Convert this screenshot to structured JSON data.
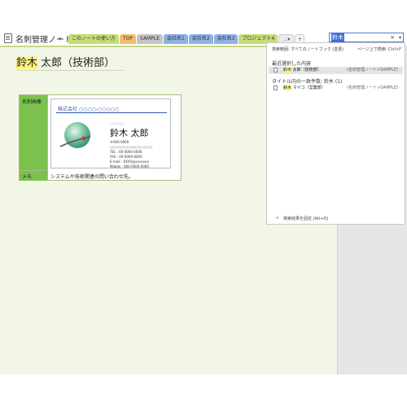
{
  "notebook": {
    "title": "名刺管理ノート",
    "caret": "▾"
  },
  "section_tabs": [
    {
      "label": "このノートの使い方",
      "color": "#c5dd77"
    },
    {
      "label": "TOP",
      "color": "#f4bd6b"
    },
    {
      "label": "SAMPLE",
      "color": "#c5c5c5"
    },
    {
      "label": "会社名1",
      "color": "#8fb1e6"
    },
    {
      "label": "会社名2",
      "color": "#8fb1e6"
    },
    {
      "label": "会社名3",
      "color": "#8fb1e6"
    },
    {
      "label": "プロジェクト4",
      "color": "#c5dd77"
    }
  ],
  "tab_more": "…▾",
  "tab_add": "+",
  "search": {
    "query": "鈴木",
    "close": "×",
    "dropdown": "▾"
  },
  "page": {
    "title_highlight": "鈴木",
    "title_rest": " 太郎（技術部）"
  },
  "table": {
    "label_card_image": "名刺画像",
    "label_memo": "メモ",
    "memo_text": "システムや技術関連の問い合わせ先。"
  },
  "card": {
    "company": "株式会社 ○○○○-○○○○○",
    "small": "○○○○○",
    "name": "鈴木 太郎",
    "postal": "〒000-0000",
    "address": "○○○○○○○○○○○○○○○",
    "tel": "TEL : 00-0000-0000",
    "fax": "FAX : 00-0000-0000",
    "email": "E-mail : XXXX@xxxxxxx",
    "mobile": "Mobile : 000-0000-0000"
  },
  "results": {
    "scope": "検索範囲: すべてのノートブック (変更)",
    "page_hint": "ページ上で検索: Ctrl+F",
    "recent_heading": "最近選択した内容",
    "recent_items": [
      {
        "highlight": "鈴木",
        "rest": " 太郎（技術部）",
        "notebook": "(名刺管理ノート>SAMPLE)"
      }
    ],
    "title_heading": "タイトル内の一致件数: 鈴木 (1)",
    "title_items": [
      {
        "highlight": "鈴木",
        "rest": " マイコ（営業部）",
        "notebook": "(名刺管理ノート>SAMPLE)"
      }
    ],
    "pin_icon": "⇥",
    "pin_label": "検索結果を固定 (Alt+O)"
  }
}
